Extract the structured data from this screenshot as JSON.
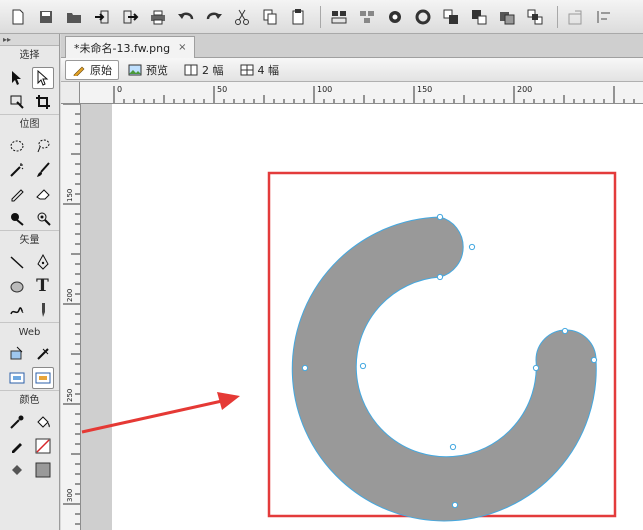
{
  "toolbar": {
    "icons": [
      "new-file-icon",
      "save-icon",
      "open-icon",
      "import-icon",
      "export-icon",
      "print-icon",
      "undo-icon",
      "redo-icon",
      "cut-icon",
      "copy-icon",
      "paste-icon",
      "group-icon",
      "ungroup-icon",
      "join-icon",
      "split-icon",
      "bring-to-front-icon",
      "bring-forward-icon",
      "send-backward-icon",
      "send-to-back-icon",
      "align-icon",
      "rotate-icon"
    ]
  },
  "tools": {
    "section_select": "选择",
    "section_bitmap": "位图",
    "section_vector": "矢量",
    "section_web": "Web",
    "section_colors": "颜色",
    "text_tool_glyph": "T"
  },
  "document": {
    "tab_title": "*未命名-13.fw.png",
    "tab_close": "×"
  },
  "views": {
    "original": "原始",
    "preview": "预览",
    "two_up": "2 幅",
    "four_up": "4 幅"
  },
  "rulers": {
    "top_labels": [
      "0",
      "50",
      "100",
      "150",
      "200"
    ],
    "left_labels": [
      "150",
      "200",
      "250",
      "300"
    ]
  },
  "colors": {
    "shape_fill": "#999999",
    "shape_stroke": "#44a8e0",
    "highlight_box": "#e33b3b",
    "arrow": "#e53935",
    "stroke_swatch": "#d7262b",
    "fill_swatch": "#999999"
  }
}
